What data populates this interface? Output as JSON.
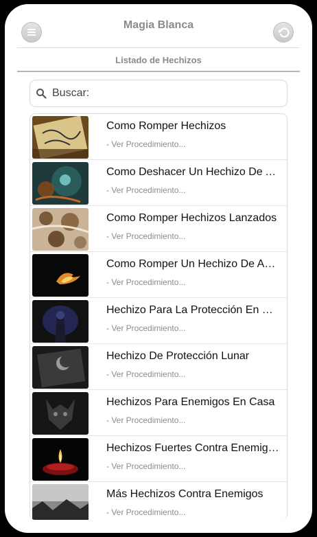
{
  "header": {
    "title": "Magia Blanca",
    "menu_icon": "menu-icon",
    "back_icon": "back-arrow-icon"
  },
  "subtitle": "Listado de Hechizos",
  "search": {
    "placeholder": "Buscar:",
    "icon": "search-icon"
  },
  "items": [
    {
      "title": "Como Romper Hechizos",
      "subtitle": "- Ver Procedimiento...",
      "thumb": "scroll-paper-thumbnail"
    },
    {
      "title": "Como Deshacer Un Hechizo De Amor",
      "subtitle": "- Ver Procedimiento...",
      "thumb": "glowing-magic-thumbnail"
    },
    {
      "title": "Como Romper Hechizos Lanzados",
      "subtitle": "- Ver Procedimiento...",
      "thumb": "sepia-pattern-thumbnail"
    },
    {
      "title": "Como Romper Un Hechizo De Amor",
      "subtitle": "- Ver Procedimiento...",
      "thumb": "fire-thumbnail"
    },
    {
      "title": "Hechizo Para La Protección En Casa",
      "subtitle": "- Ver Procedimiento...",
      "thumb": "hooded-figure-thumbnail"
    },
    {
      "title": "Hechizo De Protección Lunar",
      "subtitle": "- Ver Procedimiento...",
      "thumb": "moon-book-thumbnail"
    },
    {
      "title": "Hechizos Para Enemigos En Casa",
      "subtitle": "- Ver Procedimiento...",
      "thumb": "demon-face-thumbnail"
    },
    {
      "title": "Hechizos Fuertes Contra Enemigos",
      "subtitle": "- Ver Procedimiento...",
      "thumb": "candle-thumbnail"
    },
    {
      "title": "Más Hechizos Contra Enemigos",
      "subtitle": "- Ver Procedimiento...",
      "thumb": "dark-landscape-thumbnail"
    }
  ]
}
